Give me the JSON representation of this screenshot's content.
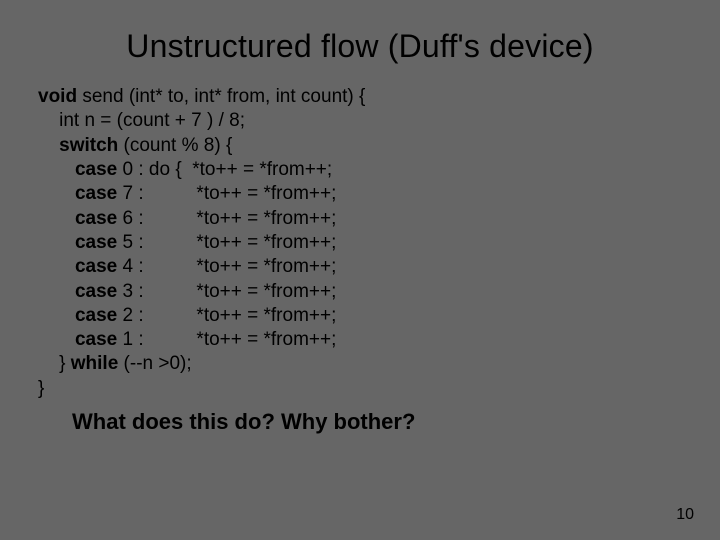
{
  "title": "Unstructured flow (Duff's device)",
  "code": {
    "l1a": "void",
    "l1b": " send (int* to, int* from, int count) {",
    "l2": "    int n = (count + 7 ) / 8;",
    "l3a": "    ",
    "l3b": "switch",
    "l3c": " (count % 8) {",
    "l4a": "       ",
    "l4b": "case",
    "l4c": " 0 : do {  *to++ = *from++;",
    "l5a": "       ",
    "l5b": "case",
    "l5c": " 7 :          *to++ = *from++;",
    "l6a": "       ",
    "l6b": "case",
    "l6c": " 6 :          *to++ = *from++;",
    "l7a": "       ",
    "l7b": "case",
    "l7c": " 5 :          *to++ = *from++;",
    "l8a": "       ",
    "l8b": "case",
    "l8c": " 4 :          *to++ = *from++;",
    "l9a": "       ",
    "l9b": "case",
    "l9c": " 3 :          *to++ = *from++;",
    "l10a": "       ",
    "l10b": "case",
    "l10c": " 2 :          *to++ = *from++;",
    "l11a": "       ",
    "l11b": "case",
    "l11c": " 1 :          *to++ = *from++;",
    "l12a": "    } ",
    "l12b": "while",
    "l12c": " (--n >0);",
    "l13": "}"
  },
  "question": "What does this do? Why bother?",
  "pagenum": "10"
}
